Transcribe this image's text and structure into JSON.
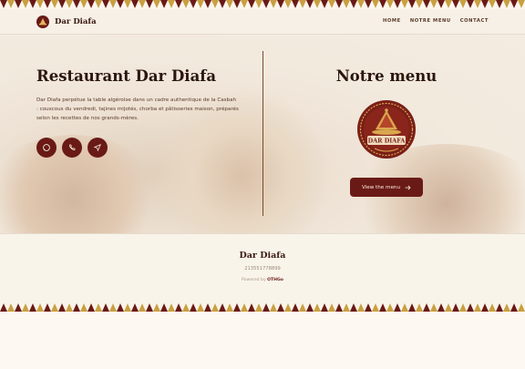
{
  "brand": {
    "name": "Dar Diafa"
  },
  "nav": {
    "items": [
      "HOME",
      "NOTRE MENU",
      "CONTACT"
    ]
  },
  "hero": {
    "title": "Restaurant Dar Diafa",
    "description": "Dar Diafa perpétue la table algéroise dans un cadre authentique de la Casbah : couscous du vendredi, tajines mijotés, chorba et pâtisseries maison, préparés selon les recettes de nos grands-mères."
  },
  "contact_icons": [
    "chat-icon",
    "phone-icon",
    "navigation-icon"
  ],
  "menu_section": {
    "title": "Notre menu",
    "emblem_text": "DAR DIAFA",
    "button_label": "View the menu"
  },
  "footer": {
    "title": "Dar Diafa",
    "phone": "213551778899",
    "powered_prefix": "Powered by",
    "powered_brand": "OTHGo"
  },
  "colors": {
    "primary": "#6a1a16",
    "accent_gold": "#c8a040",
    "background": "#fbf6ee"
  }
}
